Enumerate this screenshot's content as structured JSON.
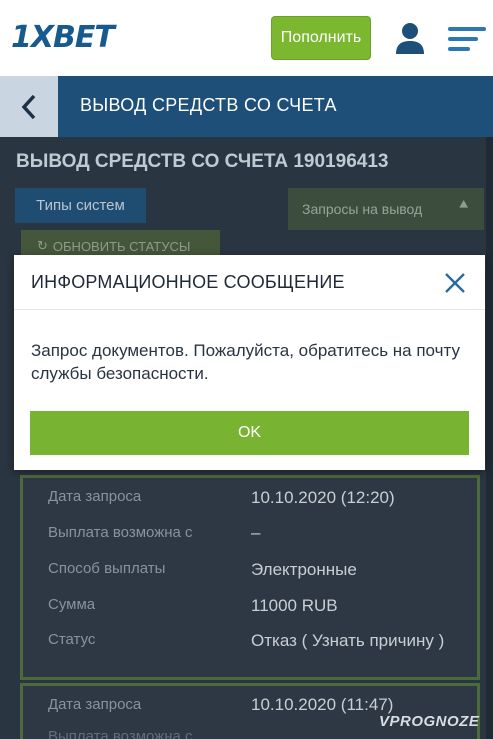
{
  "header": {
    "logo": "1XBET",
    "deposit_label": "Пополнить",
    "user_icon": "user-icon",
    "menu_icon": "menu-icon"
  },
  "titlebar": {
    "back_icon": "chevron-left-icon",
    "title": "ВЫВОД СРЕДСТВ СО СЧЕТА"
  },
  "page": {
    "title": "ВЫВОД СРЕДСТВ СО СЧЕТА 190196413",
    "tabs": [
      {
        "label": "Типы систем"
      },
      {
        "label": "Запросы на вывод",
        "icon": "double-chevron-up-icon"
      }
    ],
    "refresh_label": "ОБНОВИТЬ СТАТУСЫ",
    "refresh_icon": "refresh-icon"
  },
  "requests": [
    {
      "rows": [
        {
          "label": "Дата запроса",
          "value": "10.10.2020 (12:20)"
        },
        {
          "label": "Выплата возможна с",
          "value": "–"
        },
        {
          "label": "Способ выплаты",
          "value": "Электронные"
        },
        {
          "label": "Сумма",
          "value": "11000 RUB"
        },
        {
          "label": "Статус",
          "value": "Отказ ( Узнать причину )"
        }
      ]
    },
    {
      "rows": [
        {
          "label": "Дата запроса",
          "value": "10.10.2020 (11:47)"
        },
        {
          "label": "Выплата возможна с",
          "value": ""
        }
      ]
    }
  ],
  "modal": {
    "title": "ИНФОРМАЦИОННОЕ СООБЩЕНИЕ",
    "close_icon": "close-icon",
    "message": "Запрос документов. Пожалуйста, обратитесь на почту службы безопасности.",
    "ok_label": "OK"
  },
  "watermark": "VPROGNOZE",
  "colors": {
    "brand_blue": "#1d4f78",
    "accent_green": "#79b332",
    "logo_blue": "#175a8d"
  }
}
